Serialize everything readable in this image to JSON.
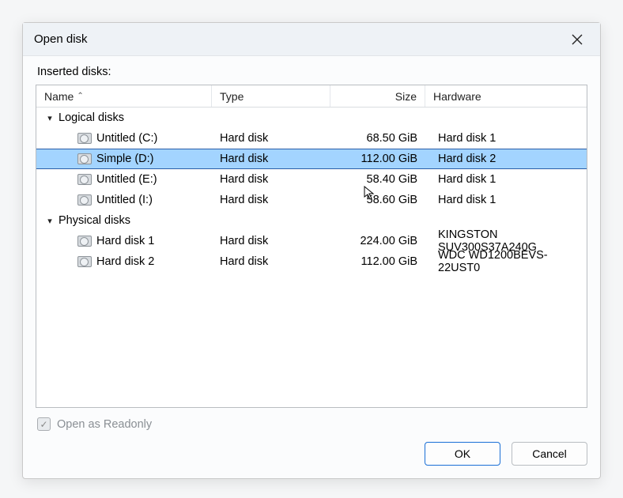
{
  "dialog": {
    "title": "Open disk",
    "section_label": "Inserted disks:",
    "columns": {
      "name": "Name",
      "type": "Type",
      "size": "Size",
      "hardware": "Hardware",
      "sort_indicator": "⌃"
    },
    "groups": {
      "logical": {
        "label": "Logical disks",
        "items": [
          {
            "name": "Untitled (C:)",
            "type": "Hard disk",
            "size": "68.50 GiB",
            "hardware": "Hard disk 1",
            "selected": false
          },
          {
            "name": "Simple (D:)",
            "type": "Hard disk",
            "size": "112.00 GiB",
            "hardware": "Hard disk 2",
            "selected": true
          },
          {
            "name": "Untitled (E:)",
            "type": "Hard disk",
            "size": "58.40 GiB",
            "hardware": "Hard disk 1",
            "selected": false
          },
          {
            "name": "Untitled (I:)",
            "type": "Hard disk",
            "size": "58.60 GiB",
            "hardware": "Hard disk 1",
            "selected": false
          }
        ]
      },
      "physical": {
        "label": "Physical disks",
        "items": [
          {
            "name": "Hard disk 1",
            "type": "Hard disk",
            "size": "224.00 GiB",
            "hardware": "KINGSTON SUV300S37A240G",
            "selected": false
          },
          {
            "name": "Hard disk 2",
            "type": "Hard disk",
            "size": "112.00 GiB",
            "hardware": "WDC WD1200BEVS-22UST0",
            "selected": false
          }
        ]
      }
    },
    "readonly_checkbox": {
      "label": "Open as Readonly",
      "checked": true,
      "disabled": true,
      "mark": "✓"
    },
    "buttons": {
      "ok": "OK",
      "cancel": "Cancel"
    }
  }
}
